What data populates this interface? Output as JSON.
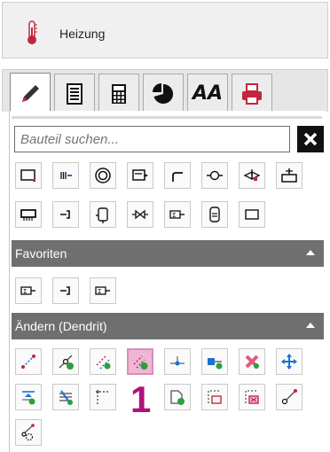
{
  "header": {
    "title": "Heizung",
    "icon": "thermometer-icon"
  },
  "tabs": [
    {
      "name": "draw",
      "icon": "pencil-icon",
      "active": true
    },
    {
      "name": "list",
      "icon": "notebook-icon",
      "active": false
    },
    {
      "name": "calc",
      "icon": "calculator-icon",
      "active": false
    },
    {
      "name": "chart",
      "icon": "pie-chart-icon",
      "active": false
    },
    {
      "name": "text",
      "icon": "text-style-icon",
      "glyph": "AA",
      "active": false
    },
    {
      "name": "print",
      "icon": "printer-icon",
      "active": false
    }
  ],
  "search": {
    "placeholder": "Bauteil suchen...",
    "value": ""
  },
  "sections": {
    "favoriten": {
      "label": "Favoriten"
    },
    "aendern": {
      "label": "Ändern (Dendrit)"
    }
  },
  "callout": {
    "label": "1"
  },
  "colors": {
    "section_bg": "#6f6f6f",
    "highlight": "#efb6d5",
    "accent_green": "#2e9e3a",
    "accent_red": "#d41c3a",
    "accent_blue": "#1f6fd1",
    "callout": "#b0127a"
  }
}
